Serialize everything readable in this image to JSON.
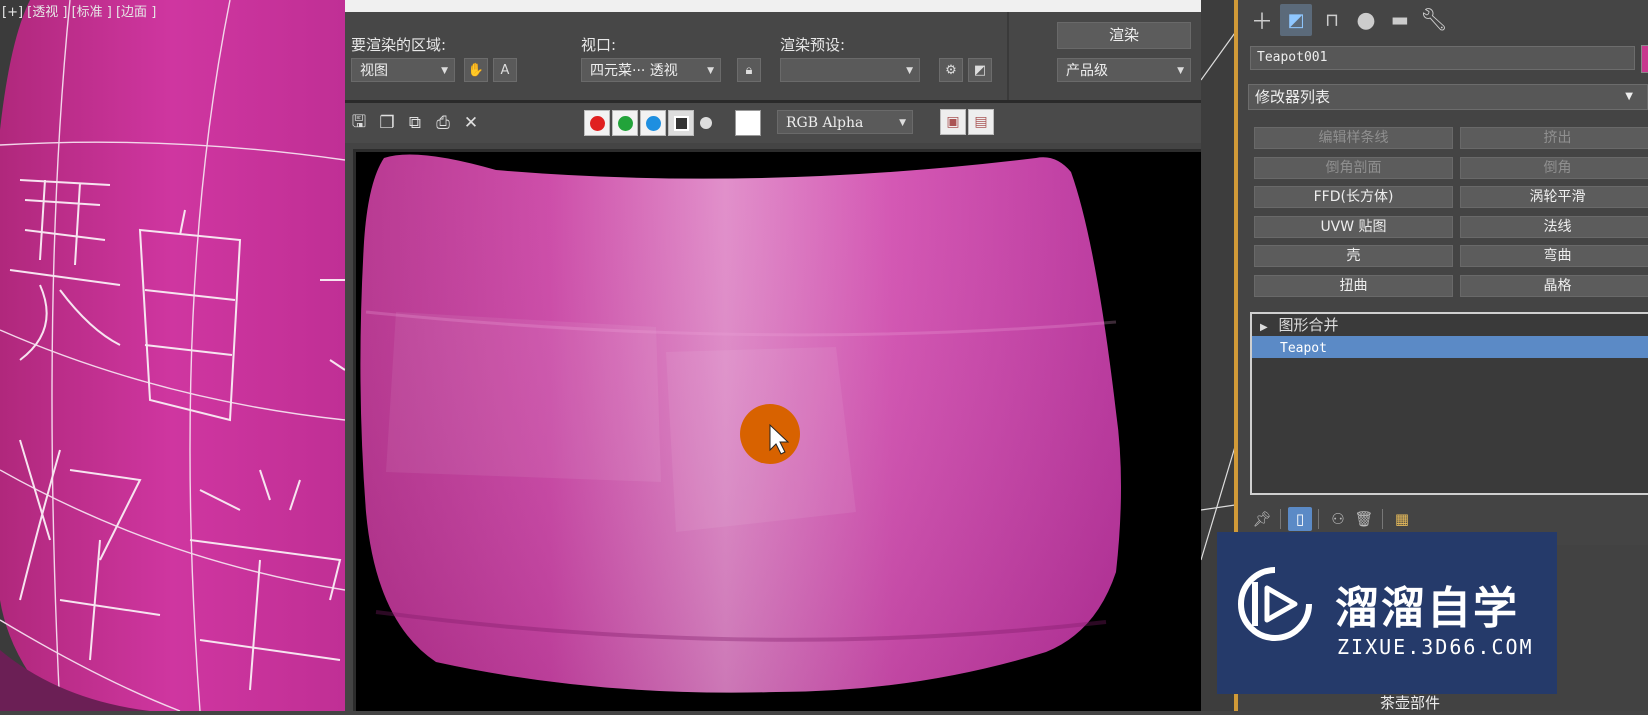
{
  "viewport": {
    "label": "[+] [透视 ] [标准 ] [边面 ]",
    "text_overlay": [
      "要",
      "自",
      "好",
      "学"
    ]
  },
  "render_window": {
    "area_label": "要渲染的区域:",
    "area_value": "视图",
    "viewport_label": "视口:",
    "viewport_value": "四元菜··· 透视",
    "preset_label": "渲染预设:",
    "preset_value": "",
    "render_button": "渲染",
    "quality_value": "产品级",
    "channel_value": "RGB Alpha",
    "channel_colors": [
      "#e02020",
      "#22a33a",
      "#1e8fe0"
    ]
  },
  "command_panel": {
    "object_name": "Teapot001",
    "object_color": "#c8388e",
    "modifier_list": "修改器列表",
    "buttons": [
      {
        "label": "编辑样条线",
        "enabled": false
      },
      {
        "label": "挤出",
        "enabled": false
      },
      {
        "label": "倒角剖面",
        "enabled": false
      },
      {
        "label": "倒角",
        "enabled": false
      },
      {
        "label": "FFD(长方体)",
        "enabled": true
      },
      {
        "label": "涡轮平滑",
        "enabled": true
      },
      {
        "label": "UVW 贴图",
        "enabled": true
      },
      {
        "label": "法线",
        "enabled": true
      },
      {
        "label": "壳",
        "enabled": true
      },
      {
        "label": "弯曲",
        "enabled": true
      },
      {
        "label": "扭曲",
        "enabled": true
      },
      {
        "label": "晶格",
        "enabled": true
      }
    ],
    "stack": [
      {
        "label": "图形合并",
        "selected": false
      },
      {
        "label": "Teapot",
        "selected": true
      }
    ],
    "rollout_label": "茶壶部件"
  },
  "watermark": {
    "title": "溜溜自学",
    "url": "ZIXUE.3D66.COM"
  }
}
